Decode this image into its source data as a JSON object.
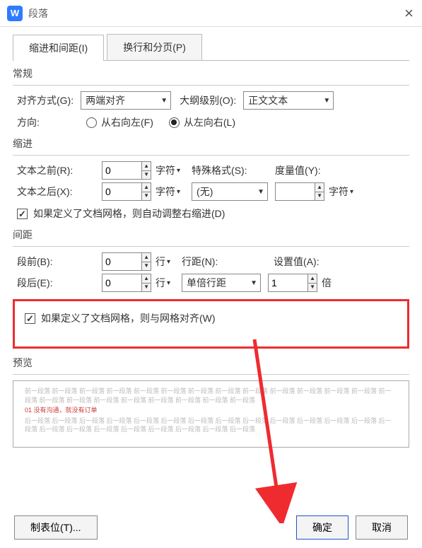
{
  "window": {
    "title": "段落",
    "icon_letter": "W"
  },
  "tabs": [
    {
      "label": "缩进和间距(I)",
      "active": true
    },
    {
      "label": "换行和分页(P)",
      "active": false
    }
  ],
  "groups": {
    "general_title": "常规",
    "indent_title": "缩进",
    "spacing_title": "间距",
    "preview_title": "预览"
  },
  "general": {
    "align_label": "对齐方式(G):",
    "align_value": "两端对齐",
    "outline_label": "大纲级别(O):",
    "outline_value": "正文文本",
    "direction_label": "方向:",
    "rtl_label": "从右向左(F)",
    "ltr_label": "从左向右(L)",
    "direction_value": "ltr"
  },
  "indent": {
    "before_label": "文本之前(R):",
    "before_value": "0",
    "before_unit": "字符",
    "after_label": "文本之后(X):",
    "after_value": "0",
    "after_unit": "字符",
    "special_label": "特殊格式(S):",
    "special_value": "(无)",
    "measure_label": "度量值(Y):",
    "measure_value": "",
    "measure_unit": "字符",
    "grid_check_label": "如果定义了文档网格，则自动调整右缩进(D)",
    "grid_check": true
  },
  "spacing": {
    "before_label": "段前(B):",
    "before_value": "0",
    "before_unit": "行",
    "after_label": "段后(E):",
    "after_value": "0",
    "after_unit": "行",
    "line_label": "行距(N):",
    "line_value": "单倍行距",
    "set_label": "设置值(A):",
    "set_value": "1",
    "set_unit": "倍",
    "grid_check_label": "如果定义了文档网格，则与网格对齐(W)",
    "grid_check": true
  },
  "preview": {
    "gray_line": "前一段落 前一段落 前一段落 前一段落 前一段落 前一段落 前一段落 前一段落 前一段落 前一段落 前一段落 前一段落 前一段落 前一段落 前一段落 前一段落 前一段落 前一段落 前一段落 前一段落 前一段落 前一段落",
    "red_line": "01 没有沟通，就没有订单",
    "gray_line2": "后一段落 后一段落 后一段落 后一段落 后一段落 后一段落 后一段落 后一段落 后一段落 后一段落 后一段落 后一段落 后一段落 后一段落 后一段落 后一段落 后一段落 后一段落 后一段落 后一段落 后一段落 后一段落"
  },
  "footer": {
    "tabs_button": "制表位(T)...",
    "ok_button": "确定",
    "cancel_button": "取消"
  }
}
